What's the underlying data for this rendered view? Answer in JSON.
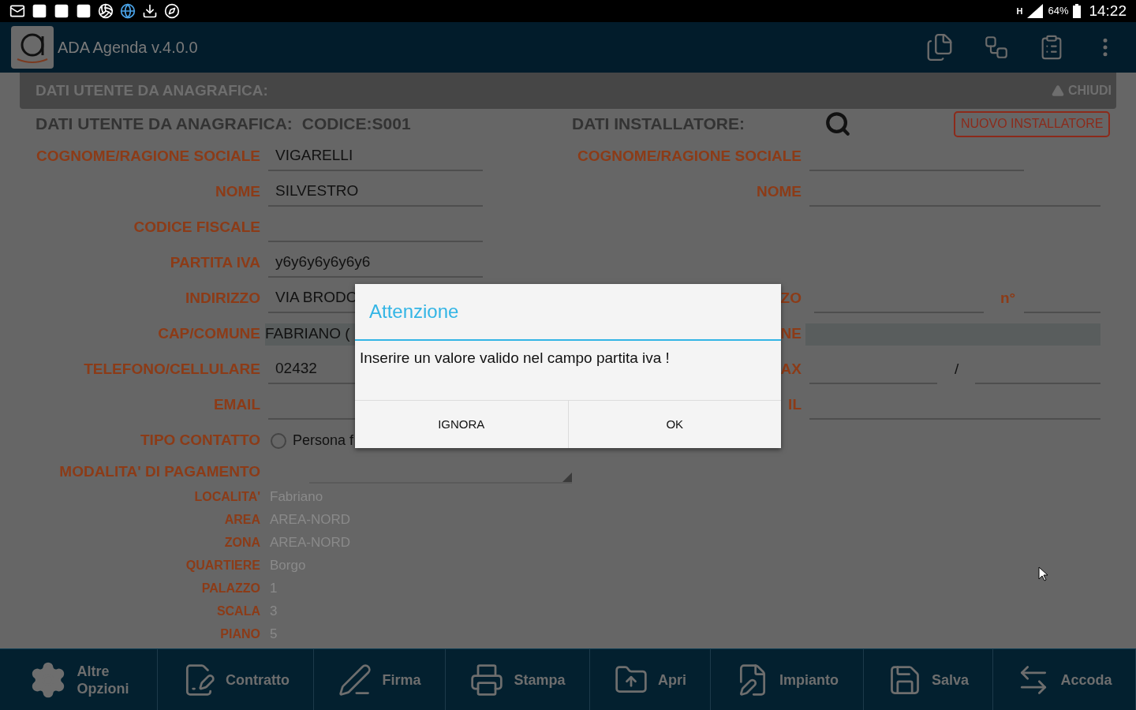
{
  "status_bar": {
    "network": "H",
    "battery": "64%",
    "time": "14:22"
  },
  "app_bar": {
    "title": "ADA Agenda v.4.0.0"
  },
  "section_header": {
    "title": "DATI UTENTE DA ANAGRAFICA:",
    "collapse_label": "CHIUDI"
  },
  "user_section": {
    "title": "DATI UTENTE DA ANAGRAFICA:",
    "code": "CODICE:S001"
  },
  "installer_section": {
    "title": "DATI INSTALLATORE:",
    "new_button": "NUOVO INSTALLATORE"
  },
  "form_rows": [
    {
      "user": {
        "kind": "field",
        "label": "COGNOME/RAGIONE SOCIALE",
        "value": "VIGARELLI"
      },
      "installer": {
        "kind": "field",
        "label": "COGNOME/RAGIONE SOCIALE"
      }
    },
    {
      "user": {
        "kind": "field",
        "label": "NOME",
        "value": "SILVESTRO"
      },
      "installer": {
        "kind": "field",
        "label": "NOME"
      }
    },
    {
      "user": {
        "kind": "field",
        "label": "CODICE FISCALE"
      }
    },
    {
      "user": {
        "kind": "field",
        "label": "PARTITA IVA",
        "value": "y6y6y6y6y6y6"
      }
    },
    {
      "user": {
        "kind": "field",
        "label": "INDIRIZZO",
        "value": "VIA BRODO"
      },
      "installer": {
        "kind": "address",
        "label": "ZO",
        "number_label": "n°"
      }
    },
    {
      "user": {
        "kind": "readonly",
        "label": "CAP/COMUNE",
        "value": "FABRIANO ("
      },
      "installer": {
        "kind": "readonly",
        "label": "NE"
      }
    },
    {
      "user": {
        "kind": "field",
        "label": "TELEFONO/CELLULARE",
        "value": "02432"
      },
      "installer": {
        "kind": "pair",
        "label": "AX",
        "separator": "/"
      }
    },
    {
      "user": {
        "kind": "field",
        "label": "EMAIL"
      },
      "installer": {
        "kind": "field",
        "label": "IL"
      }
    },
    {
      "user": {
        "kind": "radio",
        "label": "TIPO CONTATTO",
        "value": "Persona f",
        "selected": false
      }
    }
  ],
  "payment": {
    "label": "MODALITA' DI PAGAMENTO"
  },
  "details": [
    {
      "label": "LOCALITA'",
      "value": "Fabriano"
    },
    {
      "label": "AREA",
      "value": "AREA-NORD"
    },
    {
      "label": "ZONA",
      "value": "AREA-NORD"
    },
    {
      "label": "QUARTIERE",
      "value": "Borgo"
    },
    {
      "label": "PALAZZO",
      "value": "1"
    },
    {
      "label": "SCALA",
      "value": "3"
    },
    {
      "label": "PIANO",
      "value": "5"
    }
  ],
  "dialog": {
    "title": "Attenzione",
    "message": "Inserire un valore valido nel campo partita iva !",
    "buttons": [
      "IGNORA",
      "OK"
    ]
  },
  "bottom_bar": [
    "Altre\nOpzioni",
    "Contratto",
    "Firma",
    "Stampa",
    "Apri",
    "Impianto",
    "Salva",
    "Accoda"
  ]
}
